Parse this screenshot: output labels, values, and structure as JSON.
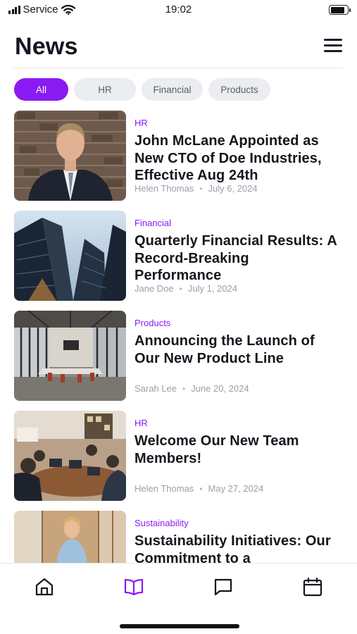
{
  "status_bar": {
    "carrier": "Service",
    "time": "19:02"
  },
  "header": {
    "title": "News",
    "menu_icon": "hamburger-menu-icon"
  },
  "filters": [
    {
      "label": "All",
      "active": true
    },
    {
      "label": "HR",
      "active": false
    },
    {
      "label": "Financial",
      "active": false
    },
    {
      "label": "Products",
      "active": false
    }
  ],
  "news": [
    {
      "category": "HR",
      "title": "John McLane Appointed as New CTO of Doe Industries, Effective Aug 24th",
      "author": "Helen Thomas",
      "date": "July 6, 2024",
      "image": "portrait-man-in-suit"
    },
    {
      "category": "Financial",
      "title": "Quarterly Financial Results: A Record-Breaking Performance",
      "author": "Jane Doe",
      "date": "July 1, 2024",
      "image": "skyscrapers"
    },
    {
      "category": "Products",
      "title": "Announcing the Launch of Our New Product Line",
      "author": "Sarah Lee",
      "date": "June 20, 2024",
      "image": "empty-office"
    },
    {
      "category": "HR",
      "title": "Welcome Our New Team Members!",
      "author": "Helen Thomas",
      "date": "May 27, 2024",
      "image": "team-meeting"
    },
    {
      "category": "Sustainability",
      "title": "Sustainability Initiatives: Our Commitment to a",
      "author": "",
      "date": "",
      "image": "woman-in-office"
    }
  ],
  "tabs": [
    {
      "name": "home",
      "icon": "home-icon",
      "active": false
    },
    {
      "name": "news",
      "icon": "book-open-icon",
      "active": true
    },
    {
      "name": "messages",
      "icon": "chat-bubble-icon",
      "active": false
    },
    {
      "name": "calendar",
      "icon": "calendar-icon",
      "active": false
    }
  ],
  "colors": {
    "accent": "#8a1bf2",
    "text": "#15161e",
    "muted": "#9c9ea8",
    "chip_bg": "#ecedf1"
  }
}
